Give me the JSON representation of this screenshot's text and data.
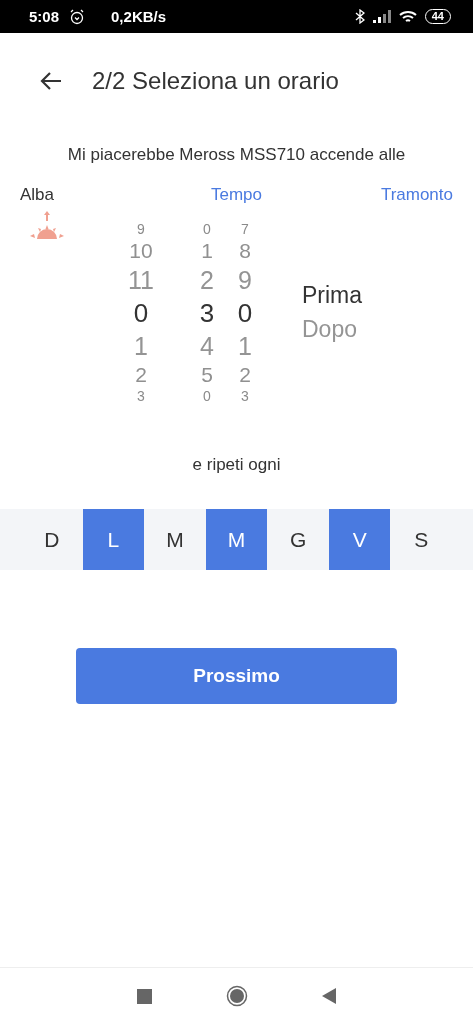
{
  "status_bar": {
    "time": "5:08",
    "speed": "0,2KB/s",
    "battery": "44"
  },
  "header": {
    "title": "2/2 Seleziona un orario"
  },
  "prompt": "Mi piacerebbe Meross MSS710 accende alle",
  "modes": [
    {
      "label": "Alba",
      "selected": true
    },
    {
      "label": "Tempo",
      "selected": false
    },
    {
      "label": "Tramonto",
      "selected": false
    }
  ],
  "picker": {
    "wheels": [
      {
        "items": [
          {
            "label": "9",
            "selected": false
          },
          {
            "label": "10",
            "selected": false
          },
          {
            "label": "11",
            "selected": false
          },
          {
            "label": "0",
            "selected": true
          },
          {
            "label": "1",
            "selected": false
          },
          {
            "label": "2",
            "selected": false
          },
          {
            "label": "3",
            "selected": false
          }
        ]
      },
      {
        "items": [
          {
            "label": "0",
            "selected": false
          },
          {
            "label": "1",
            "selected": false
          },
          {
            "label": "2",
            "selected": false
          },
          {
            "label": "3",
            "selected": true
          },
          {
            "label": "4",
            "selected": false
          },
          {
            "label": "5",
            "selected": false
          },
          {
            "label": "0",
            "selected": false
          }
        ]
      },
      {
        "items": [
          {
            "label": "7",
            "selected": false
          },
          {
            "label": "8",
            "selected": false
          },
          {
            "label": "9",
            "selected": false
          },
          {
            "label": "0",
            "selected": true
          },
          {
            "label": "1",
            "selected": false
          },
          {
            "label": "2",
            "selected": false
          },
          {
            "label": "3",
            "selected": false
          }
        ]
      }
    ],
    "offset": [
      {
        "label": "Prima",
        "selected": true
      },
      {
        "label": "Dopo",
        "selected": false
      }
    ]
  },
  "repeat_label": "e ripeti ogni",
  "days": [
    {
      "label": "D",
      "selected": false
    },
    {
      "label": "L",
      "selected": true
    },
    {
      "label": "M",
      "selected": false
    },
    {
      "label": "M",
      "selected": true
    },
    {
      "label": "G",
      "selected": false
    },
    {
      "label": "V",
      "selected": true
    },
    {
      "label": "S",
      "selected": false
    }
  ],
  "next_button": "Prossimo"
}
